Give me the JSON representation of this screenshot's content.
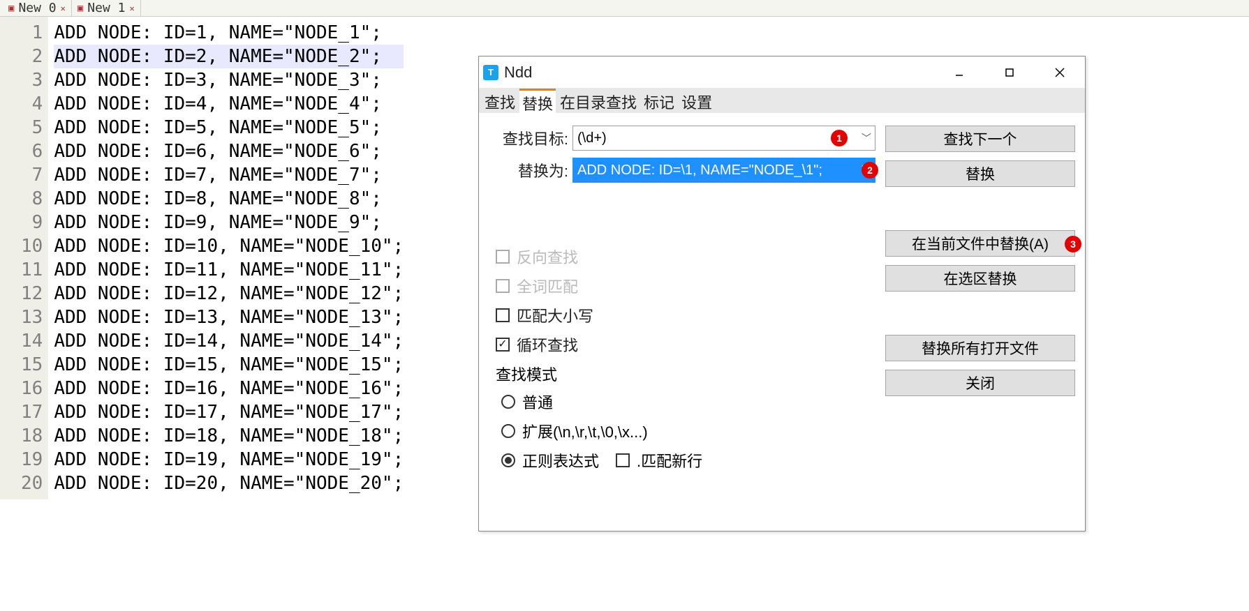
{
  "tabs": [
    "New 0",
    "New 1"
  ],
  "code_lines": [
    "ADD NODE: ID=1, NAME=\"NODE_1\";",
    "ADD NODE: ID=2, NAME=\"NODE_2\";",
    "ADD NODE: ID=3, NAME=\"NODE_3\";",
    "ADD NODE: ID=4, NAME=\"NODE_4\";",
    "ADD NODE: ID=5, NAME=\"NODE_5\";",
    "ADD NODE: ID=6, NAME=\"NODE_6\";",
    "ADD NODE: ID=7, NAME=\"NODE_7\";",
    "ADD NODE: ID=8, NAME=\"NODE_8\";",
    "ADD NODE: ID=9, NAME=\"NODE_9\";",
    "ADD NODE: ID=10, NAME=\"NODE_10\";",
    "ADD NODE: ID=11, NAME=\"NODE_11\";",
    "ADD NODE: ID=12, NAME=\"NODE_12\";",
    "ADD NODE: ID=13, NAME=\"NODE_13\";",
    "ADD NODE: ID=14, NAME=\"NODE_14\";",
    "ADD NODE: ID=15, NAME=\"NODE_15\";",
    "ADD NODE: ID=16, NAME=\"NODE_16\";",
    "ADD NODE: ID=17, NAME=\"NODE_17\";",
    "ADD NODE: ID=18, NAME=\"NODE_18\";",
    "ADD NODE: ID=19, NAME=\"NODE_19\";",
    "ADD NODE: ID=20, NAME=\"NODE_20\";"
  ],
  "highlight_line_index": 1,
  "dialog": {
    "title": "Ndd",
    "tabs": [
      "查找",
      "替换",
      "在目录查找",
      "标记",
      "设置"
    ],
    "active_tab_index": 1,
    "find_label": "查找目标:",
    "find_value": "(\\d+)",
    "replace_label": "替换为:",
    "replace_value": "ADD NODE: ID=\\1, NAME=\"NODE_\\1\";",
    "checks": {
      "reverse": {
        "label": "反向查找",
        "checked": false,
        "disabled": true
      },
      "whole_word": {
        "label": "全词匹配",
        "checked": false,
        "disabled": true
      },
      "match_case": {
        "label": "匹配大小写",
        "checked": false,
        "disabled": false
      },
      "wrap": {
        "label": "循环查找",
        "checked": true,
        "disabled": false
      }
    },
    "mode_heading": "查找模式",
    "modes": {
      "normal": {
        "label": "普通",
        "checked": false
      },
      "extended": {
        "label": "扩展(\\n,\\r,\\t,\\0,\\x...)",
        "checked": false
      },
      "regex": {
        "label": "正则表达式",
        "checked": true
      },
      "dot_nl": {
        "label": ".匹配新行",
        "checked": false
      }
    },
    "buttons": {
      "find_next": "查找下一个",
      "replace": "替换",
      "replace_all_file": "在当前文件中替换(A)",
      "replace_in_selection": "在选区替换",
      "replace_all_open": "替换所有打开文件",
      "close": "关闭"
    },
    "badges": {
      "1": "1",
      "2": "2",
      "3": "3"
    }
  }
}
